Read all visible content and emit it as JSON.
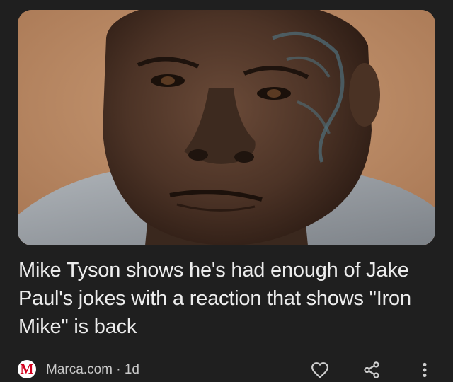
{
  "article": {
    "image_alt": "Mike Tyson close-up portrait",
    "headline": "Mike Tyson shows he's had enough of Jake Paul's jokes with a reaction that shows \"Iron Mike\" is back",
    "source": {
      "logo_letter": "M",
      "name": "Marca.com",
      "separator": "·",
      "age": "1d"
    }
  },
  "actions": {
    "like_icon": "heart-outline-icon",
    "share_icon": "share-icon",
    "more_icon": "more-vertical-icon"
  },
  "colors": {
    "background": "#1f1f1f",
    "text": "#ececec",
    "meta_text": "#c8c8c8",
    "brand_red": "#d3001d"
  }
}
